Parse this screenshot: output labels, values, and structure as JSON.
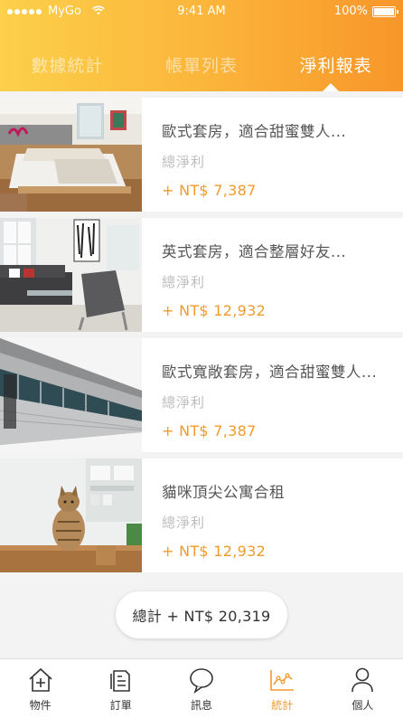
{
  "status_bar": {
    "carrier": "MyGo",
    "time": "9:41 AM",
    "battery": "100%"
  },
  "tabs": [
    {
      "label": "數據統計",
      "active": false
    },
    {
      "label": "帳單列表",
      "active": false
    },
    {
      "label": "淨利報表",
      "active": true
    }
  ],
  "listings": [
    {
      "title": "歐式套房，適合甜蜜雙人...",
      "subtitle": "總淨利",
      "amount": "+ NT$ 7,387",
      "image": "bedroom-photo"
    },
    {
      "title": "英式套房，適合整層好友...",
      "subtitle": "總淨利",
      "amount": "+ NT$ 12,932",
      "image": "living-room-photo"
    },
    {
      "title": "歐式寬敞套房，適合甜蜜雙人...",
      "subtitle": "總淨利",
      "amount": "+ NT$ 7,387",
      "image": "building-exterior-photo"
    },
    {
      "title": "貓咪頂尖公寓合租",
      "subtitle": "總淨利",
      "amount": "+ NT$ 12,932",
      "image": "cat-kitchen-photo"
    }
  ],
  "total": "總計 + NT$ 20,319",
  "bottom_nav": [
    {
      "label": "物件",
      "icon": "house-plus-icon",
      "active": false
    },
    {
      "label": "訂單",
      "icon": "document-icon",
      "active": false
    },
    {
      "label": "訊息",
      "icon": "chat-bubble-icon",
      "active": false
    },
    {
      "label": "統計",
      "icon": "line-chart-icon",
      "active": true
    },
    {
      "label": "個人",
      "icon": "person-icon",
      "active": false
    }
  ],
  "colors": {
    "accent": "#f39a2c",
    "header_start": "#fcd04a",
    "header_end": "#f8962a"
  }
}
